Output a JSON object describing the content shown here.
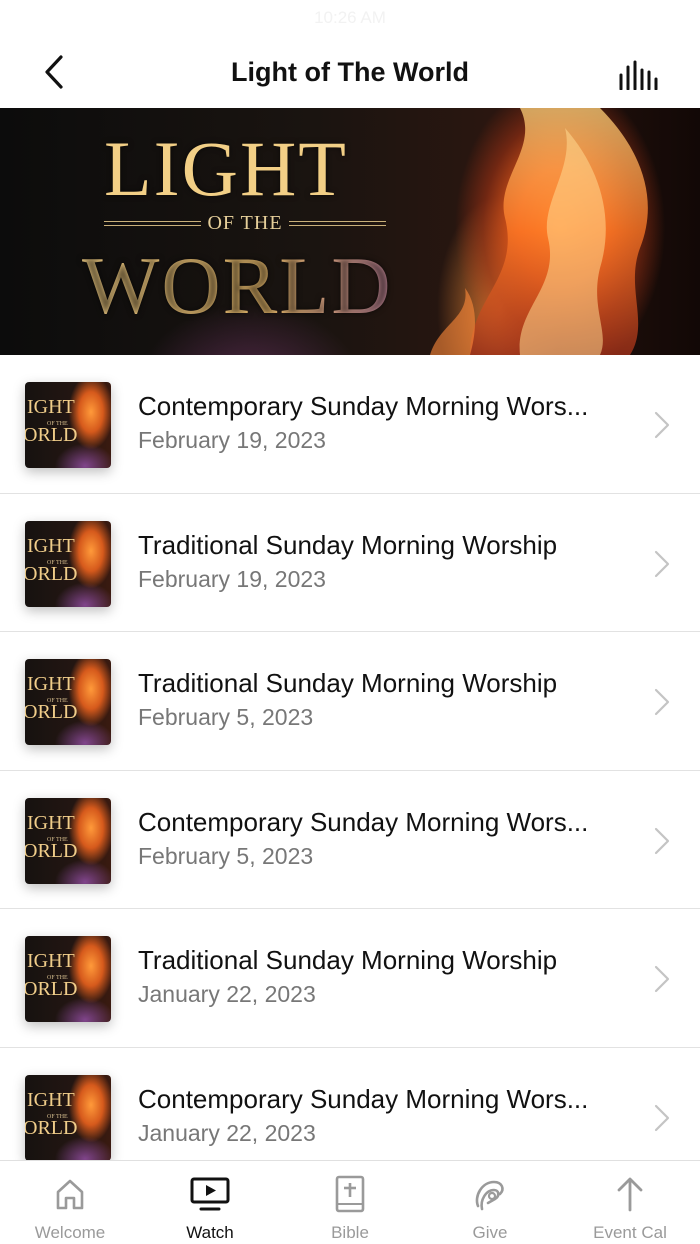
{
  "status_bar": {
    "time": "10:26 AM"
  },
  "nav": {
    "title": "Light of The World",
    "back_icon": "chevron-left-icon",
    "audio_icon": "audio-bars-icon"
  },
  "hero": {
    "line1": "LIGHT",
    "line2": "OF THE",
    "line3": "WORLD"
  },
  "thumbnail_text": {
    "line1": "IGHT",
    "line2": "OF THE",
    "line3": "ORLD"
  },
  "items": [
    {
      "title": "Contemporary Sunday Morning Wors...",
      "date": "February 19, 2023"
    },
    {
      "title": "Traditional Sunday Morning Worship",
      "date": "February 19, 2023"
    },
    {
      "title": "Traditional Sunday Morning Worship",
      "date": "February 5, 2023"
    },
    {
      "title": "Contemporary Sunday Morning Wors...",
      "date": "February 5, 2023"
    },
    {
      "title": "Traditional Sunday Morning Worship",
      "date": "January 22, 2023"
    },
    {
      "title": "Contemporary Sunday Morning Wors...",
      "date": "January 22, 2023"
    }
  ],
  "tabs": [
    {
      "label": "Welcome",
      "icon": "home-icon"
    },
    {
      "label": "Watch",
      "icon": "tv-play-icon",
      "active": true
    },
    {
      "label": "Bible",
      "icon": "bible-icon"
    },
    {
      "label": "Give",
      "icon": "give-icon"
    },
    {
      "label": "Event Cal",
      "icon": "arrow-up-icon"
    }
  ],
  "colors": {
    "accent": "#111111",
    "inactive": "#9a9a9a",
    "hero_gold": "#f2cf86"
  }
}
